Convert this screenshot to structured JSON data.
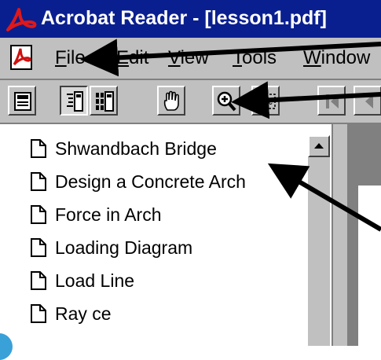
{
  "window": {
    "title": "Acrobat Reader - [lesson1.pdf]"
  },
  "menu": [
    {
      "label": "File",
      "underline": "F",
      "rest": "ile"
    },
    {
      "label": "Edit",
      "underline": "E",
      "rest": "dit"
    },
    {
      "label": "View",
      "underline": "V",
      "rest": "iew"
    },
    {
      "label": "Tools",
      "underline": "T",
      "rest": "ools"
    },
    {
      "label": "Window",
      "underline": "W",
      "rest": "indow"
    }
  ],
  "toolbar": {
    "buttons": [
      "page-only-icon",
      "bookmarks-and-page-icon",
      "thumbnails-and-page-icon",
      "hand-tool-icon",
      "zoom-in-tool-icon",
      "text-select-tool-icon",
      "first-page-icon"
    ]
  },
  "bookmarks": [
    "Shwandbach Bridge",
    "Design a Concrete Arch",
    "Force in Arch",
    "Loading Diagram",
    "Load Line",
    "Ray ce"
  ],
  "colors": {
    "titlebar": "#0a1f8f",
    "chrome": "#c0c0c0",
    "acrobat_red": "#d01010"
  }
}
